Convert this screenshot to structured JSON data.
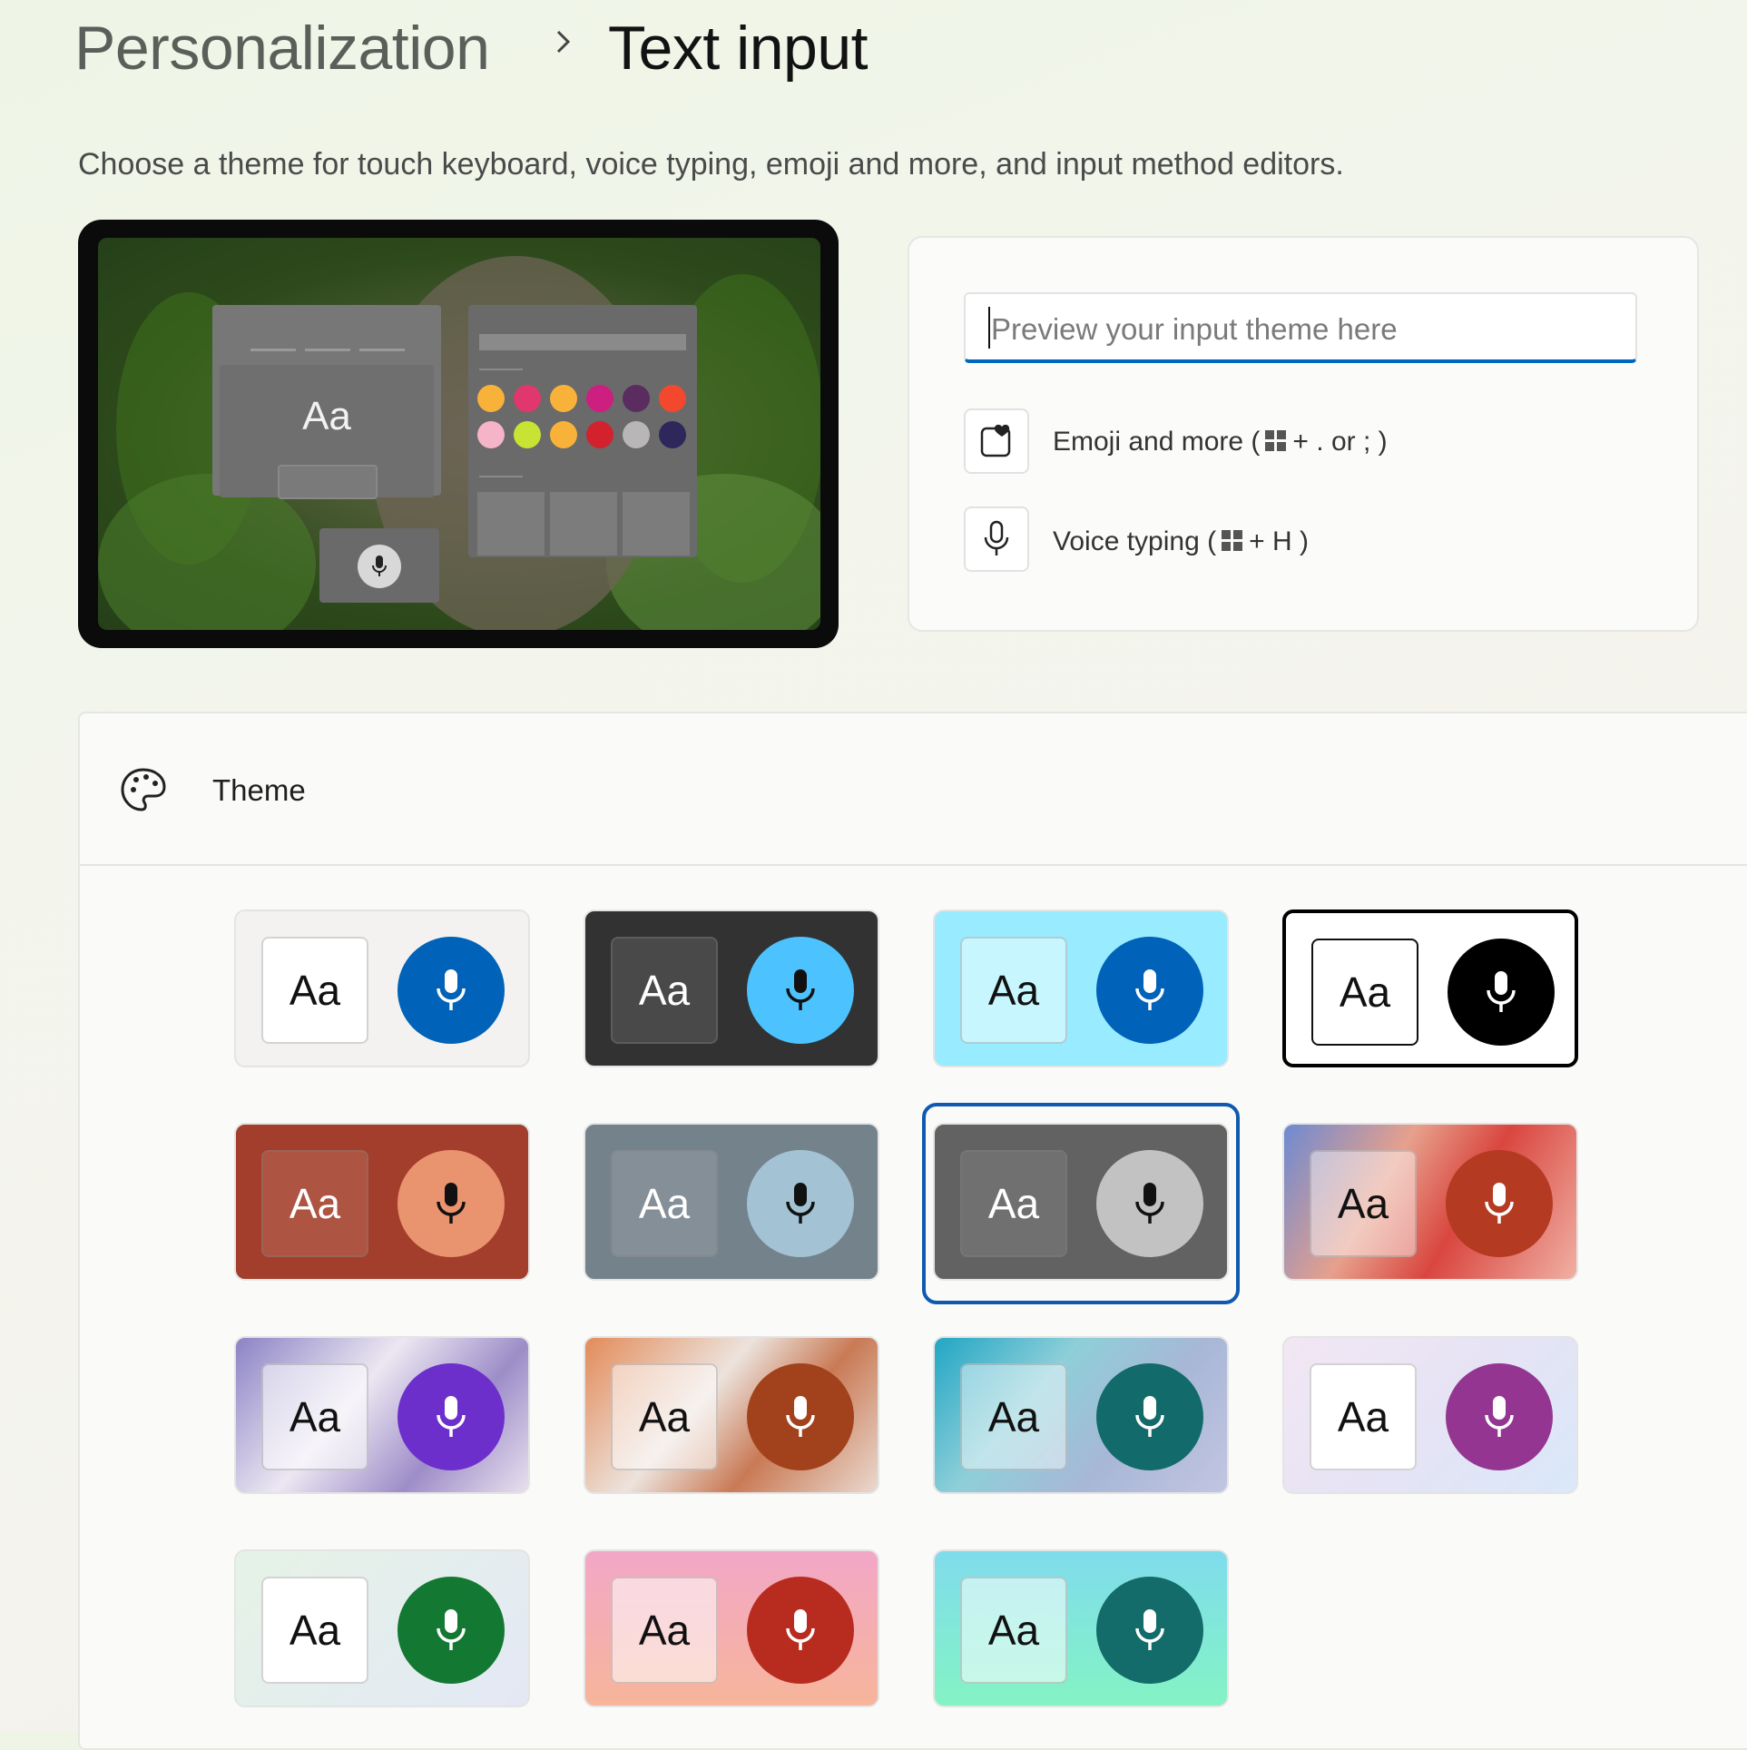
{
  "breadcrumb": {
    "parent": "Personalization",
    "current": "Text input"
  },
  "subtitle": "Choose a theme for touch keyboard, voice typing, emoji and more, and input method editors.",
  "preview": {
    "keyboard_label": "Aa",
    "emoji_colors": [
      "#f8b23a",
      "#e0376f",
      "#f8b23a",
      "#cc1f80",
      "#5a2c5f",
      "#f3482e",
      "#f5b4c8",
      "#c9e335",
      "#f8b23a",
      "#d2222e",
      "#b9b6b8",
      "#2e275c"
    ]
  },
  "preview_card": {
    "input_placeholder": "Preview your input theme here",
    "emoji_row": {
      "icon": "emoji-heart-icon",
      "label_before": "Emoji and more (",
      "label_after": "+ . or ; )"
    },
    "voice_row": {
      "icon": "microphone-icon",
      "label_before": "Voice typing (",
      "label_after": "+ H )"
    }
  },
  "theme_section": {
    "label": "Theme",
    "icon": "palette-icon",
    "selected_index": 6,
    "tiles": [
      {
        "aa": "Aa",
        "bg": "#f3f2f1",
        "aa_bg": "#ffffff",
        "aa_fg": "#111111",
        "mic_bg": "#0062b8",
        "mic_fg": "#ffffff",
        "border": "#e4e4e4"
      },
      {
        "aa": "Aa",
        "bg": "#323232",
        "aa_bg": "#494949",
        "aa_fg": "#ffffff",
        "mic_bg": "#4cc2ff",
        "mic_fg": "#111111",
        "border": "#e4e4e4"
      },
      {
        "aa": "Aa",
        "bg": "#99ebff",
        "aa_bg": "#c8f6ff",
        "aa_fg": "#111111",
        "mic_bg": "#0062b8",
        "mic_fg": "#ffffff",
        "border": "#e4e4e4"
      },
      {
        "aa": "Aa",
        "bg": "#ffffff",
        "aa_bg": "#ffffff",
        "aa_fg": "#111111",
        "mic_bg": "#000000",
        "mic_fg": "#ffffff",
        "border": "#000000"
      },
      {
        "aa": "Aa",
        "bg": "#a23e2b",
        "aa_bg": "#ad5442",
        "aa_fg": "#ffffff",
        "mic_bg": "#ea946f",
        "mic_fg": "#111111",
        "border": "#e4e4e4"
      },
      {
        "aa": "Aa",
        "bg": "#74828c",
        "aa_bg": "#858f97",
        "aa_fg": "#ffffff",
        "mic_bg": "#a3c3d4",
        "mic_fg": "#111111",
        "border": "#e4e4e4"
      },
      {
        "aa": "Aa",
        "bg": "#626262",
        "aa_bg": "#707070",
        "aa_fg": "#ffffff",
        "mic_bg": "#c2c2c2",
        "mic_fg": "#111111",
        "border": "#e4e4e4"
      },
      {
        "aa": "Aa",
        "bg": "linear-gradient(120deg,#6d8ad2 0%,#e7a08c 35%,#d9463f 60%,#f0b0a4 100%)",
        "aa_bg": "rgba(255,255,255,0.45)",
        "aa_fg": "#111111",
        "mic_bg": "#b53a22",
        "mic_fg": "#ffffff",
        "border": "#e4e4e4"
      },
      {
        "aa": "Aa",
        "bg": "linear-gradient(130deg,#8b83c5 0%,#ece7f2 40%,#9d8dc8 70%,#e8e0ee 100%)",
        "aa_bg": "rgba(255,255,255,0.55)",
        "aa_fg": "#111111",
        "mic_bg": "#6d2fcc",
        "mic_fg": "#ffffff",
        "border": "#e4e4e4"
      },
      {
        "aa": "Aa",
        "bg": "linear-gradient(130deg,#e38b59 0%,#ece3dd 40%,#c97a55 65%,#ead9cf 100%)",
        "aa_bg": "rgba(255,255,255,0.5)",
        "aa_fg": "#111111",
        "mic_bg": "#a2421c",
        "mic_fg": "#ffffff",
        "border": "#e4e4e4"
      },
      {
        "aa": "Aa",
        "bg": "linear-gradient(130deg,#22a6c4 0%,#8ecfd9 35%,#a8b7d6 65%,#c2c5e2 100%)",
        "aa_bg": "rgba(255,255,255,0.45)",
        "aa_fg": "#111111",
        "mic_bg": "#126b6a",
        "mic_fg": "#ffffff",
        "border": "#e4e4e4"
      },
      {
        "aa": "Aa",
        "bg": "linear-gradient(135deg,#f2e7f3 0%,#e6e3f5 50%,#d9e8f8 100%)",
        "aa_bg": "#ffffff",
        "aa_fg": "#111111",
        "mic_bg": "#943691",
        "mic_fg": "#ffffff",
        "border": "#e4e4e4"
      },
      {
        "aa": "Aa",
        "bg": "linear-gradient(135deg,#e5f3e6 0%,#e4e8f5 100%)",
        "aa_bg": "#ffffff",
        "aa_fg": "#111111",
        "mic_bg": "#137832",
        "mic_fg": "#ffffff",
        "border": "#e4e4e4"
      },
      {
        "aa": "Aa",
        "bg": "linear-gradient(180deg,#f2a7c7 0%,#f7b59a 100%)",
        "aa_bg": "rgba(255,255,255,0.55)",
        "aa_fg": "#111111",
        "mic_bg": "#b82c1f",
        "mic_fg": "#ffffff",
        "border": "#e4e4e4"
      },
      {
        "aa": "Aa",
        "bg": "linear-gradient(180deg,#7fdcec 0%,#84f3c4 100%)",
        "aa_bg": "rgba(255,255,255,0.55)",
        "aa_fg": "#111111",
        "mic_bg": "#136b6a",
        "mic_fg": "#ffffff",
        "border": "#e4e4e4"
      }
    ]
  }
}
